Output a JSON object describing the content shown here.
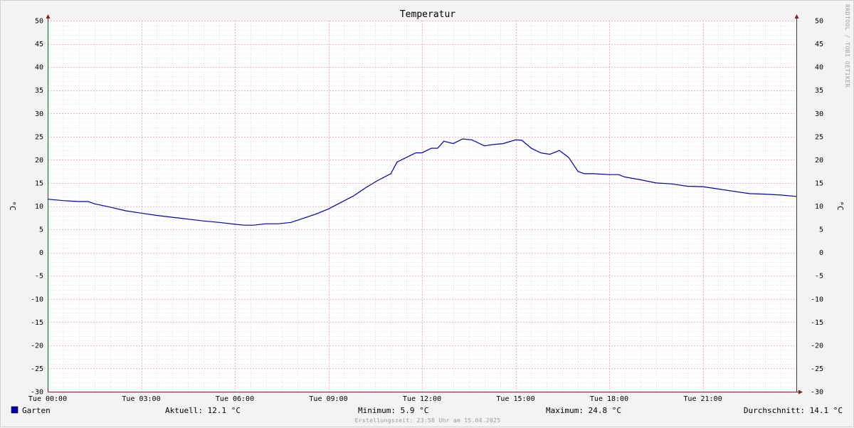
{
  "watermark": "RRDTOOL / TOBI OETIKER",
  "footer": "Erstellungszeit: 23:58 Uhr am 15.04.2025",
  "legend": {
    "series_name": "Garten",
    "current": "Aktuell: 12.1 °C",
    "minimum": "Minimum: 5.9 °C",
    "maximum": "Maximum: 24.8 °C",
    "average": "Durchschnitt: 14.1 °C"
  },
  "colors": {
    "series": "#0000aa",
    "major_grid": "#e6a0a0",
    "minor_grid": "#c8c8c8",
    "axis": "#802020",
    "plot_bg": "#ffffff",
    "page_bg": "#f3f3f3"
  },
  "chart_data": {
    "type": "line",
    "title": "Temperatur",
    "ylabel_left": "°C",
    "ylabel_right": "°C",
    "xlim": [
      0,
      24
    ],
    "ylim": [
      -30,
      50
    ],
    "y_ticks": [
      -30,
      -25,
      -20,
      -15,
      -10,
      -5,
      0,
      5,
      10,
      15,
      20,
      25,
      30,
      35,
      40,
      45,
      50
    ],
    "x_ticks": [
      {
        "hour": 0,
        "label": "Tue 00:00"
      },
      {
        "hour": 3,
        "label": "Tue 03:00"
      },
      {
        "hour": 6,
        "label": "Tue 06:00"
      },
      {
        "hour": 9,
        "label": "Tue 09:00"
      },
      {
        "hour": 12,
        "label": "Tue 12:00"
      },
      {
        "hour": 15,
        "label": "Tue 15:00"
      },
      {
        "hour": 18,
        "label": "Tue 18:00"
      },
      {
        "hour": 21,
        "label": "Tue 21:00"
      }
    ],
    "grid": true,
    "legend_position": "bottom",
    "series": [
      {
        "name": "Garten",
        "x": [
          0,
          0.5,
          1,
          1.3,
          1.5,
          2,
          2.5,
          3,
          3.5,
          4,
          4.5,
          5,
          5.5,
          6,
          6.3,
          6.6,
          7,
          7.4,
          7.8,
          8.2,
          8.6,
          9,
          9.4,
          9.8,
          10.2,
          10.6,
          11,
          11.2,
          11.5,
          11.8,
          12,
          12.3,
          12.5,
          12.7,
          13,
          13.3,
          13.6,
          14,
          14.3,
          14.6,
          15,
          15.2,
          15.5,
          15.8,
          16.1,
          16.4,
          16.7,
          17,
          17.2,
          17.5,
          18,
          18.3,
          18.5,
          19,
          19.5,
          20,
          20.5,
          21,
          21.5,
          22,
          22.5,
          23,
          23.5,
          24
        ],
        "y": [
          11.5,
          11.2,
          11.0,
          11.0,
          10.5,
          9.8,
          9.0,
          8.5,
          8.0,
          7.6,
          7.2,
          6.8,
          6.5,
          6.1,
          5.9,
          5.9,
          6.2,
          6.2,
          6.5,
          7.4,
          8.3,
          9.4,
          10.8,
          12.2,
          14.0,
          15.6,
          17.0,
          19.5,
          20.5,
          21.5,
          21.5,
          22.5,
          22.5,
          24.0,
          23.5,
          24.5,
          24.3,
          23.0,
          23.3,
          23.5,
          24.3,
          24.2,
          22.5,
          21.5,
          21.2,
          22.0,
          20.5,
          17.5,
          17.0,
          17.0,
          16.8,
          16.8,
          16.3,
          15.7,
          15.0,
          14.8,
          14.3,
          14.2,
          13.7,
          13.2,
          12.7,
          12.6,
          12.4,
          12.1
        ]
      }
    ]
  }
}
